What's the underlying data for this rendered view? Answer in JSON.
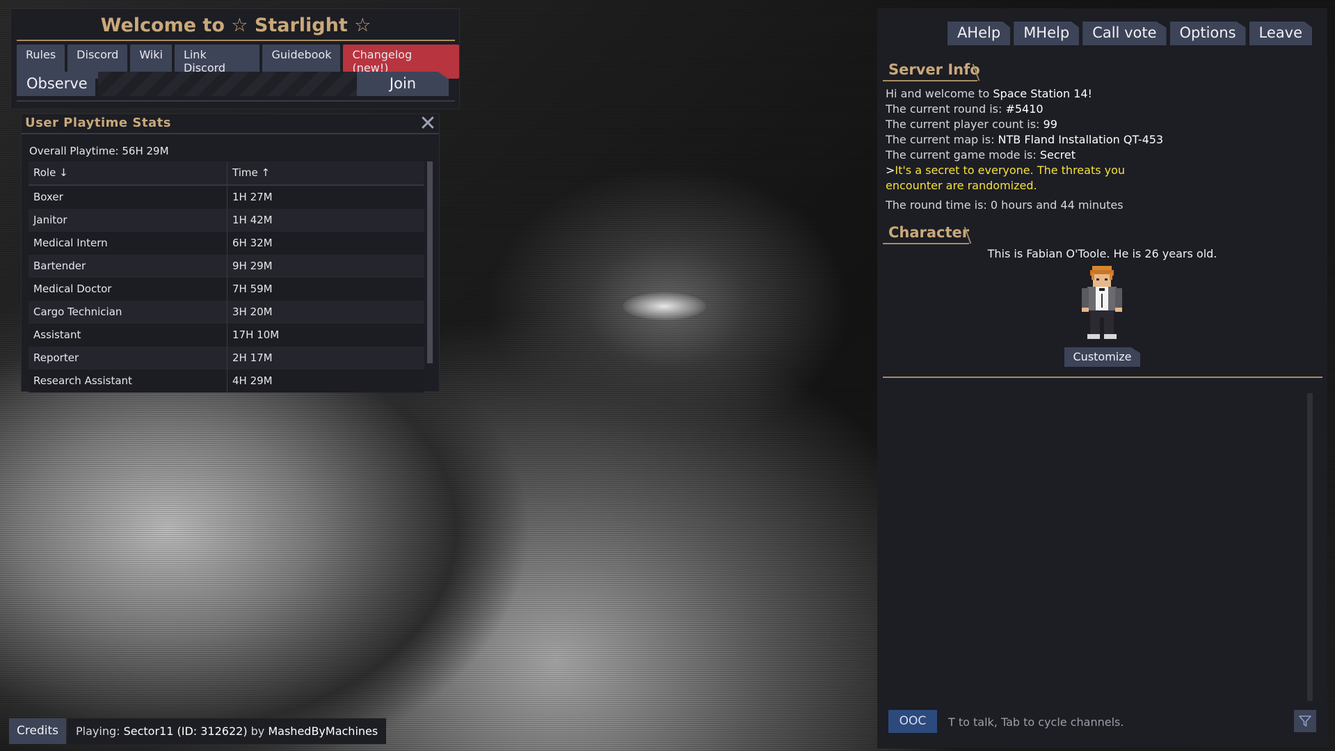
{
  "header": {
    "title": "Welcome to ☆ Starlight ☆",
    "links": [
      "Rules",
      "Discord",
      "Wiki",
      "Link Discord",
      "Guidebook",
      "Changelog (new!)"
    ],
    "observe_label": "Observe",
    "join_label": "Join"
  },
  "playtime": {
    "title": "User Playtime Stats",
    "overall": "Overall Playtime: 56H 29M",
    "col_role": "Role ↓",
    "col_time": "Time ↑",
    "rows": [
      {
        "role": "Boxer",
        "time": "1H 27M"
      },
      {
        "role": "Janitor",
        "time": "1H 42M"
      },
      {
        "role": "Medical Intern",
        "time": "6H 32M"
      },
      {
        "role": "Bartender",
        "time": "9H 29M"
      },
      {
        "role": "Medical Doctor",
        "time": "7H 59M"
      },
      {
        "role": "Cargo Technician",
        "time": "3H 20M"
      },
      {
        "role": "Assistant",
        "time": "17H 10M"
      },
      {
        "role": "Reporter",
        "time": "2H 17M"
      },
      {
        "role": "Research Assistant",
        "time": "4H 29M"
      }
    ]
  },
  "top_buttons": [
    "AHelp",
    "MHelp",
    "Call vote",
    "Options",
    "Leave"
  ],
  "server_info": {
    "title": "Server Info",
    "welcome_prefix": "Hi and welcome to ",
    "welcome_name": "Space Station 14!",
    "round_prefix": "The current round is: ",
    "round_value": "#5410",
    "players_prefix": "The current player count is: ",
    "players_value": "99",
    "map_prefix": "The current map is: ",
    "map_value": "NTB Fland Installation QT-453",
    "mode_prefix": "The current game mode is: ",
    "mode_value": "Secret",
    "mode_desc_line1": "It's a secret to everyone. The threats you",
    "mode_desc_line2": "encounter are randomized.",
    "round_time": "The round time is: 0 hours and 44 minutes"
  },
  "character": {
    "title": "Character",
    "description": "This is Fabian O'Toole. He is 26 years old.",
    "customize_label": "Customize"
  },
  "chat": {
    "channel": "OOC",
    "placeholder": "T to talk, Tab to cycle channels."
  },
  "footer": {
    "credits_label": "Credits",
    "playing_prefix": "Playing: ",
    "playing_track": "Sector11 (ID: 312622)",
    "playing_by": " by ",
    "playing_artist": "MashedByMachines"
  },
  "colors": {
    "accent_gold": "#c9a97a",
    "button": "#3d4458",
    "changelog": "#b8343e",
    "panel": "#1d1d24",
    "highlight_yellow": "#f2e23a"
  }
}
